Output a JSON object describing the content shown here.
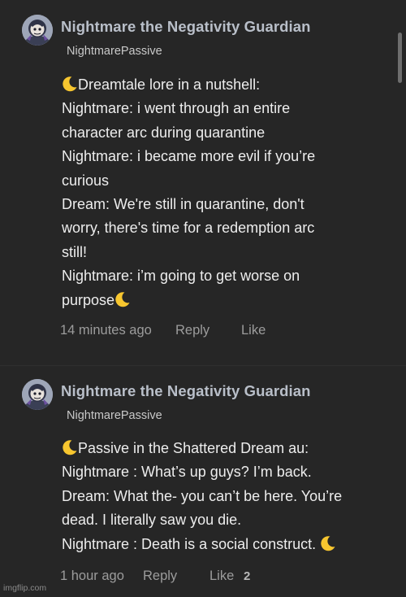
{
  "comments": [
    {
      "username": "Nightmare the Negativity Guardian",
      "subtitle": "NightmarePassive",
      "lines": [
        "Dreamtale lore in a nutshell:",
        "Nightmare: i went through an entire",
        "character arc during quarantine",
        "Nightmare: i became more evil if you’re",
        "curious",
        "Dream: We're still in quarantine, don't",
        "worry, there's time for a redemption arc",
        "still!",
        "Nightmare: i’m going to get worse on",
        "purpose"
      ],
      "timestamp": "14 minutes ago",
      "reply_label": "Reply",
      "like_label": "Like",
      "like_count": ""
    },
    {
      "username": "Nightmare the Negativity Guardian",
      "subtitle": "NightmarePassive",
      "lines": [
        "Passive in the Shattered Dream au:",
        "Nightmare : What’s up guys? I’m back.",
        "Dream: What the- you can’t be here. You’re",
        "dead. I literally saw you die.",
        "Nightmare : Death is a social construct."
      ],
      "timestamp": "1 hour ago",
      "reply_label": "Reply",
      "like_label": "Like",
      "like_count": "2"
    }
  ],
  "watermark": "imgflip.com",
  "icons": {
    "moon": "crescent-moon-emoji",
    "avatar": "nightmare-character-avatar"
  },
  "colors": {
    "background": "#262626",
    "username": "#b9bfc9",
    "body": "#ededed",
    "meta": "#9c9c9c",
    "moon": "#f7c62f"
  }
}
